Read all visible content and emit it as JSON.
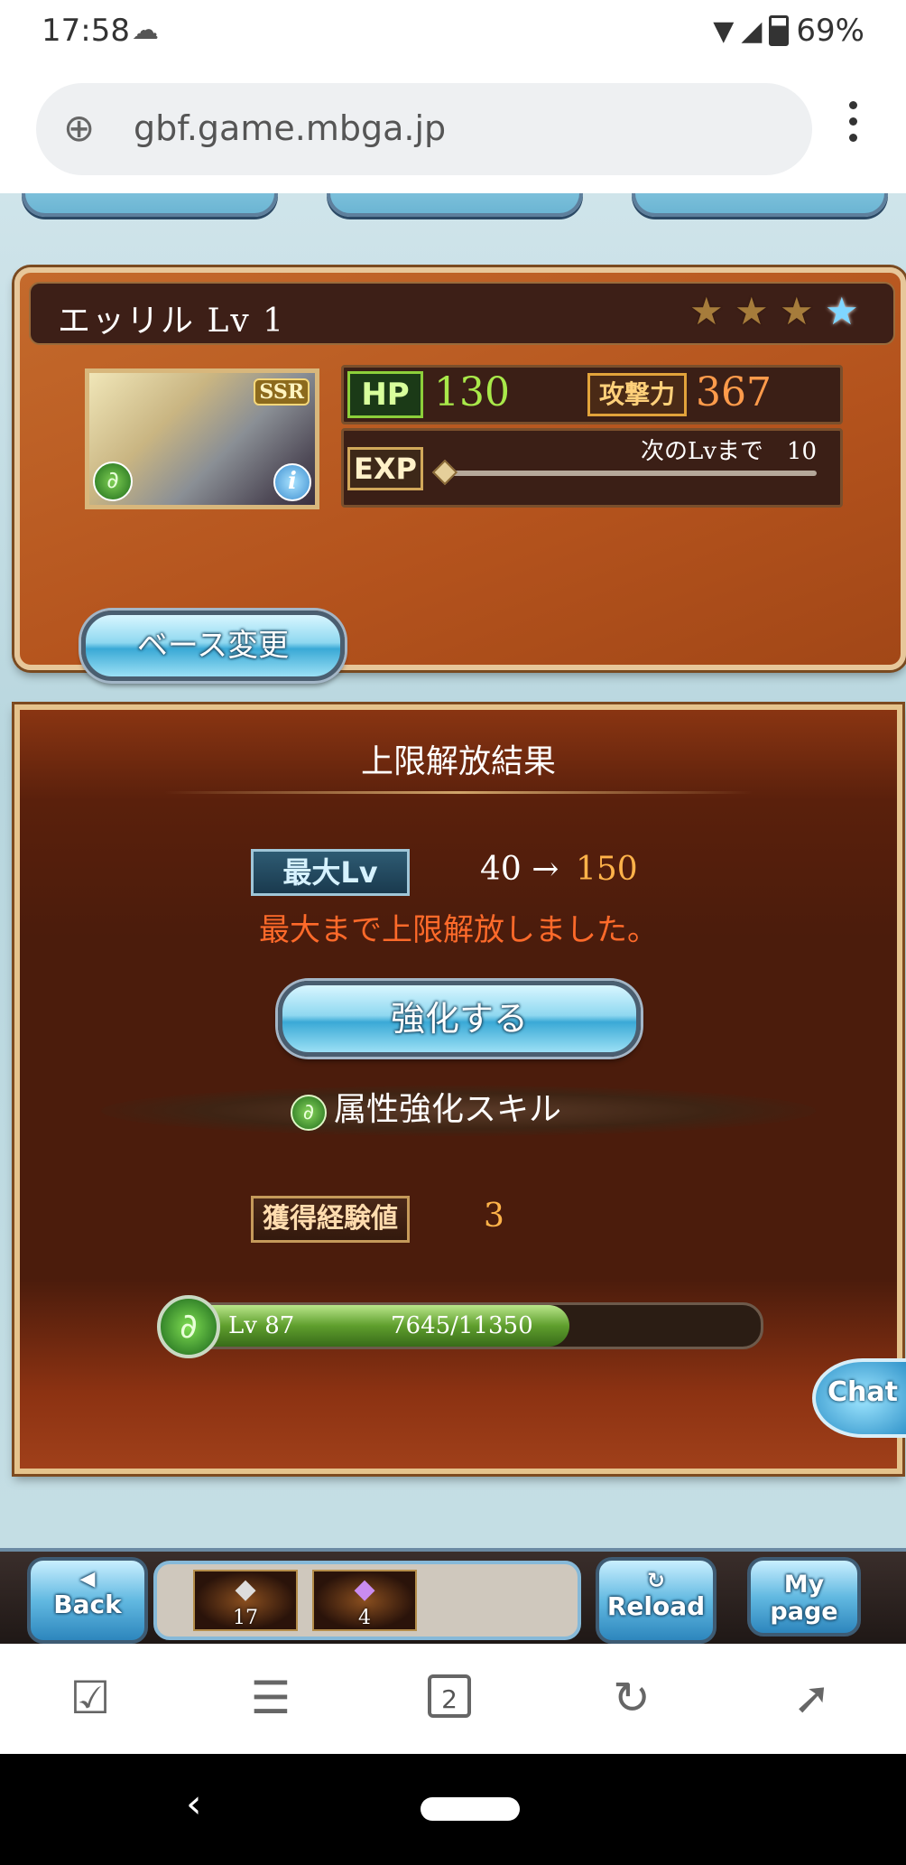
{
  "status_bar": {
    "time": "17:58",
    "battery": "69%"
  },
  "browser": {
    "url": "gbf.game.mbga.jp",
    "tab_count": "2"
  },
  "character": {
    "name": "エッリル Lv 1",
    "rarity": "SSR",
    "stars_total": 4,
    "hp_label": "HP",
    "hp": "130",
    "atk_label": "攻撃力",
    "atk": "367",
    "exp_label": "EXP",
    "exp_next": "次のLvまで　10",
    "base_change_label": "ベース変更"
  },
  "result": {
    "title": "上限解放結果",
    "max_lv_label": "最大Lv",
    "lv_from": "40 →",
    "lv_to": "150",
    "message": "最大まで上限解放しました。",
    "enhance_label": "強化する",
    "skill_label": "属性強化スキル",
    "gained_exp_label": "獲得経験値",
    "gained_exp": "3",
    "skill_level": "Lv 87",
    "skill_exp": "7645/11350",
    "skill_exp_fraction": 0.6736
  },
  "chat_label": "Chat",
  "game_bar": {
    "back_label": "Back",
    "reload_label": "Reload",
    "mypage_label": "My page",
    "items": [
      {
        "icon": "silver-item-icon",
        "qty": "17"
      },
      {
        "icon": "purple-item-icon",
        "qty": "4"
      }
    ]
  },
  "colors": {
    "accent_orange": "#ff6a2a",
    "hp_green": "#a9e94a",
    "atk_orange": "#ff9b4b"
  }
}
